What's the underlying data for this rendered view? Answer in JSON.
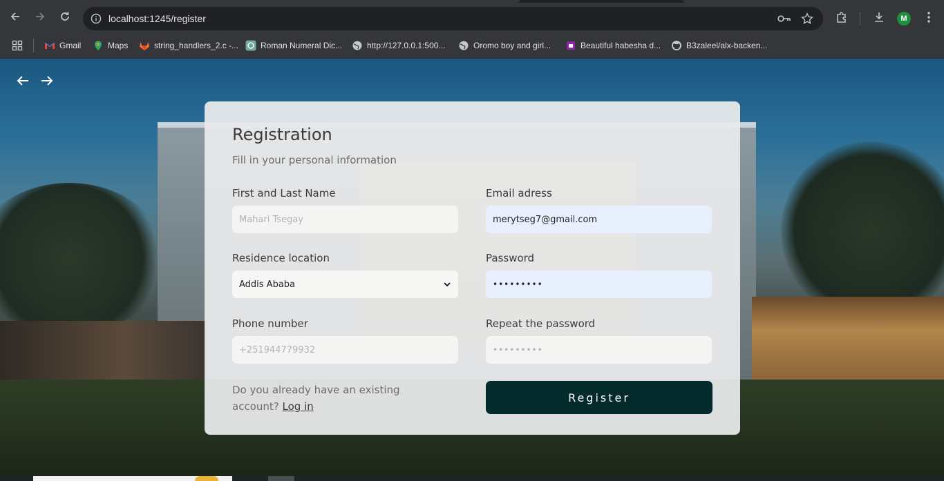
{
  "browser": {
    "url": "localhost:1245/register",
    "profile_initial": "M",
    "bookmarks": [
      {
        "label": "Gmail",
        "icon": "gmail-icon"
      },
      {
        "label": "Maps",
        "icon": "maps-icon"
      },
      {
        "label": "string_handlers_2.c -...",
        "icon": "gitlab-icon"
      },
      {
        "label": "Roman Numeral Dic...",
        "icon": "chatgpt-icon"
      },
      {
        "label": "http://127.0.0.1:500...",
        "icon": "globe-icon"
      },
      {
        "label": "Oromo boy and girl...",
        "icon": "globe-icon"
      },
      {
        "label": "Beautiful habesha d...",
        "icon": "purple-app-icon"
      },
      {
        "label": "B3zaleel/alx-backen...",
        "icon": "github-icon"
      }
    ]
  },
  "form": {
    "title": "Registration",
    "subtitle": "Fill in your personal information",
    "name": {
      "label": "First and Last Name",
      "placeholder": "Mahari Tsegay",
      "value": ""
    },
    "email": {
      "label": "Email adress",
      "value": "merytseg7@gmail.com"
    },
    "location": {
      "label": "Residence location",
      "selected": "Addis Ababa"
    },
    "password": {
      "label": "Password",
      "value": "•••••••••"
    },
    "phone": {
      "label": "Phone number",
      "placeholder": "+251944779932",
      "value": ""
    },
    "repeat_password": {
      "label": "Repeat the password",
      "placeholder": "•••••••••",
      "value": ""
    },
    "account_prompt": "Do you already have an existing account?",
    "login_link": "Log in",
    "register_label": "Register"
  },
  "colors": {
    "register_button": "#042b2c",
    "card_background": "#e9eaeb",
    "autofill_background": "#e8f0fe"
  }
}
